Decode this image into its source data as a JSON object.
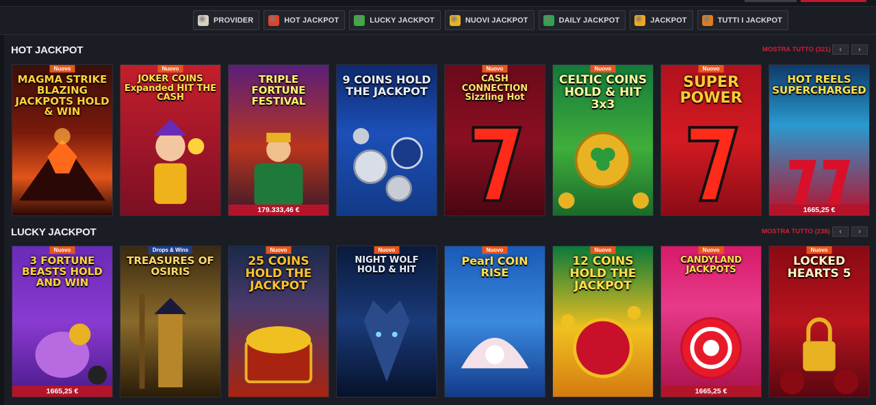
{
  "filters": [
    {
      "label": "PROVIDER",
      "icon": "provider-icon",
      "color": "#d9d2c2"
    },
    {
      "label": "HOT JACKPOT",
      "icon": "flame-icon",
      "color": "#e3412a"
    },
    {
      "label": "LUCKY JACKPOT",
      "icon": "clover-icon",
      "color": "#3cae3b"
    },
    {
      "label": "NUOVI JACKPOT",
      "icon": "bell-icon",
      "color": "#e8b223"
    },
    {
      "label": "DAILY JACKPOT",
      "icon": "calendar-icon",
      "color": "#2fa44a"
    },
    {
      "label": "JACKPOT",
      "icon": "coin-icon",
      "color": "#f0a91c"
    },
    {
      "label": "TUTTI I JACKPOT",
      "icon": "bells-icon",
      "color": "#e27c1d"
    }
  ],
  "hot": {
    "title": "HOT JACKPOT",
    "show_all": "MOSTRA TUTTO (321)",
    "games": [
      {
        "name": "MAGMA STRIKE BLAZING JACKPOTS HOLD & WIN",
        "badge": "Nuovo",
        "amount": ""
      },
      {
        "name": "JOKER COINS Expanded HIT THE CASH",
        "badge": "Nuovo",
        "amount": ""
      },
      {
        "name": "TRIPLE FORTUNE FESTIVAL",
        "badge": "",
        "amount": "179.333,46 €"
      },
      {
        "name": "9 COINS HOLD THE JACKPOT",
        "badge": "",
        "amount": ""
      },
      {
        "name": "CASH CONNECTION Sizzling Hot",
        "badge": "Nuovo",
        "amount": ""
      },
      {
        "name": "CELTIC COINS HOLD & HIT 3x3",
        "badge": "Nuovo",
        "amount": ""
      },
      {
        "name": "SUPER POWER",
        "badge": "Nuovo",
        "amount": ""
      },
      {
        "name": "HOT REELS SUPERCHARGED",
        "badge": "",
        "amount": "1665,25 €"
      }
    ]
  },
  "lucky": {
    "title": "LUCKY JACKPOT",
    "show_all": "MOSTRA TUTTO (238)",
    "games": [
      {
        "name": "3 FORTUNE BEASTS HOLD AND WIN",
        "badge": "Nuovo",
        "amount": "1665,25 €"
      },
      {
        "name": "TREASURES OF OSIRIS",
        "badge": "Drops & Wins",
        "amount": ""
      },
      {
        "name": "25 COINS HOLD THE JACKPOT",
        "badge": "Nuovo",
        "amount": ""
      },
      {
        "name": "NIGHT WOLF HOLD & HIT",
        "badge": "Nuovo",
        "amount": ""
      },
      {
        "name": "Pearl COIN RISE",
        "badge": "Nuovo",
        "amount": ""
      },
      {
        "name": "12 COINS HOLD THE JACKPOT",
        "badge": "Nuovo",
        "amount": ""
      },
      {
        "name": "CANDYLAND JACKPOTS",
        "badge": "Nuovo",
        "amount": "1665,25 €"
      },
      {
        "name": "LOCKED HEARTS 5",
        "badge": "Nuovo",
        "amount": ""
      }
    ]
  },
  "nav": {
    "prev": "‹",
    "next": "›"
  }
}
